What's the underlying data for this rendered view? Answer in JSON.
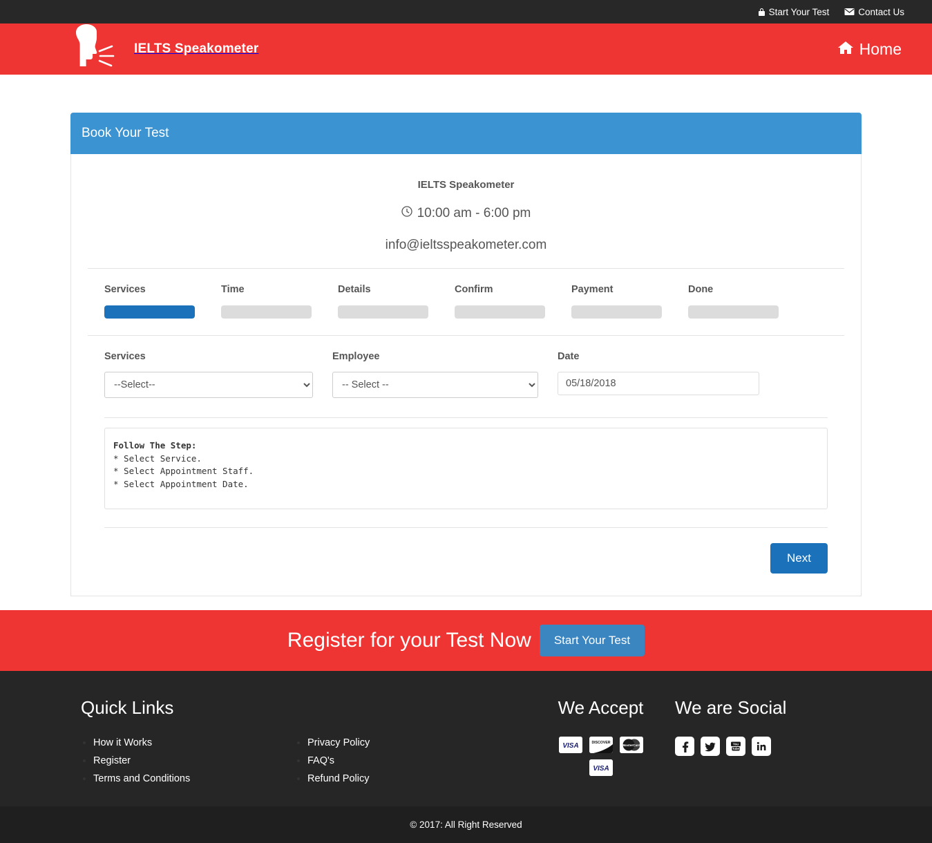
{
  "colors": {
    "brand_red": "#ef3434",
    "panel_blue": "#3b93d2",
    "button_blue": "#1b72ba",
    "cta_button_blue": "#3b85c0",
    "topbar_dark": "#282828",
    "footer_dark": "#262626",
    "copyright_dark": "#1f1f1f",
    "step_inactive_gray": "#dcdcdc"
  },
  "topbar": {
    "links": [
      {
        "label": "Start Your Test",
        "icon": "lock-icon"
      },
      {
        "label": "Contact Us",
        "icon": "envelope-icon"
      }
    ]
  },
  "header": {
    "brand_name": "IELTS Speakometer",
    "logo_icon": "speaking-head-icon",
    "nav": [
      {
        "label": "Home",
        "icon": "home-icon"
      }
    ]
  },
  "panel": {
    "heading": "Book Your Test"
  },
  "business": {
    "name": "IELTS Speakometer",
    "hours": "10:00 am - 6:00 pm",
    "hours_icon": "clock-icon",
    "email": "info@ieltsspeakometer.com"
  },
  "steps": [
    {
      "label": "Services",
      "active": true
    },
    {
      "label": "Time",
      "active": false
    },
    {
      "label": "Details",
      "active": false
    },
    {
      "label": "Confirm",
      "active": false
    },
    {
      "label": "Payment",
      "active": false
    },
    {
      "label": "Done",
      "active": false
    }
  ],
  "form": {
    "services": {
      "label": "Services",
      "value": "--Select--",
      "options": [
        "--Select--"
      ]
    },
    "employee": {
      "label": "Employee",
      "value": "-- Select --",
      "options": [
        "-- Select --"
      ]
    },
    "date": {
      "label": "Date",
      "value": "05/18/2018",
      "placeholder": "05/18/2018"
    }
  },
  "instructions": {
    "heading": "Follow The Step:",
    "lines": [
      "* Select Service.",
      "* Select Appointment Staff.",
      "* Select Appointment Date."
    ],
    "body": "\n* Select Service.\n* Select Appointment Staff.\n* Select Appointment Date."
  },
  "actions": {
    "next_label": "Next"
  },
  "cta": {
    "text": "Register for your Test Now",
    "button_label": "Start Your Test"
  },
  "footer": {
    "quick_links": {
      "title": "Quick Links",
      "column1": [
        "How it Works",
        "Register",
        "Terms and Conditions"
      ],
      "column2": [
        "Privacy Policy",
        "FAQ's",
        "Refund Policy"
      ]
    },
    "we_accept": {
      "title": "We Accept",
      "cards_row1": [
        "visa-card-icon",
        "discover-card-icon",
        "mastercard-card-icon"
      ],
      "cards_row2": [
        "visa-card-icon"
      ]
    },
    "we_social": {
      "title": "We are Social",
      "icons": [
        "facebook-icon",
        "twitter-icon",
        "youtube-icon",
        "linkedin-icon"
      ]
    },
    "copyright": "© 2017: All Right Reserved"
  }
}
